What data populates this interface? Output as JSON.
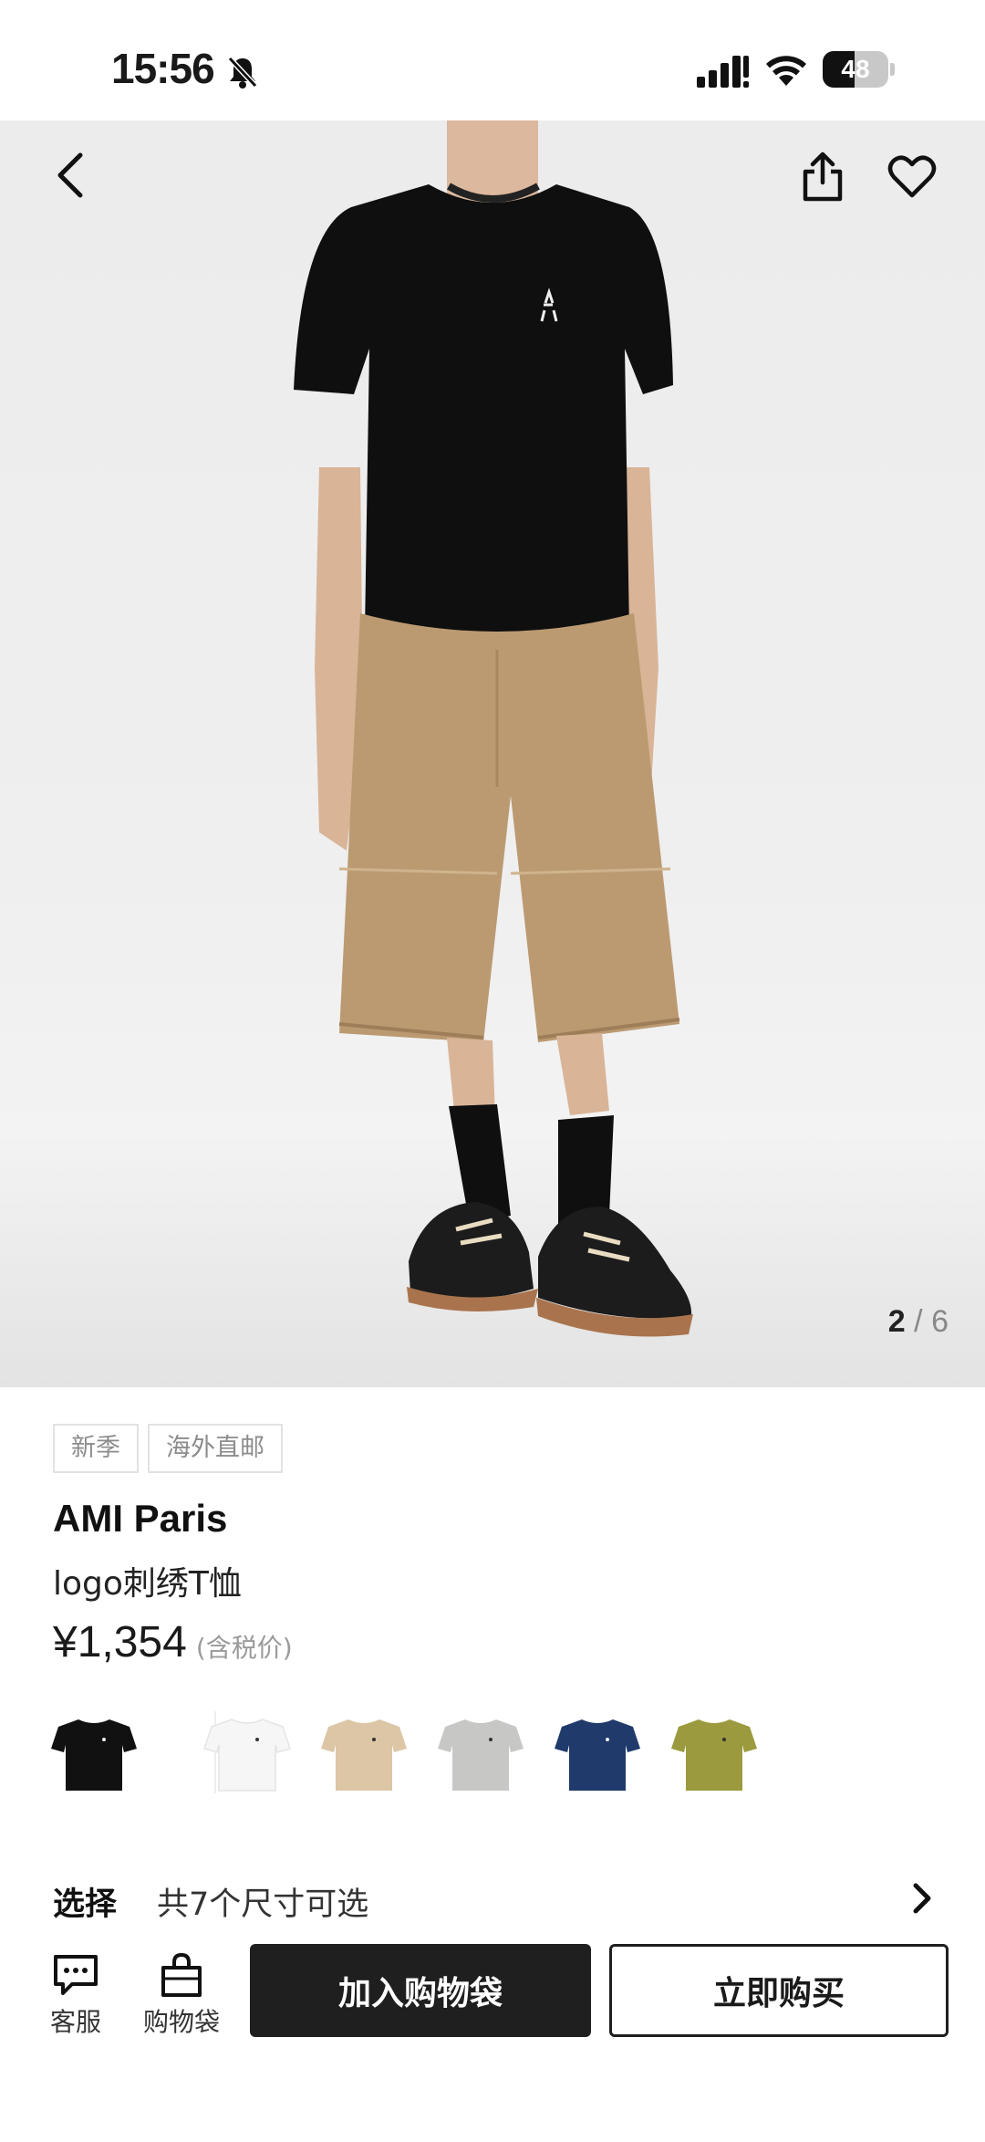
{
  "status_bar": {
    "time": "15:56",
    "battery": "48",
    "battery_level": 0.48
  },
  "gallery": {
    "current": "2",
    "separator": "/",
    "total": "6"
  },
  "tags": [
    "新季",
    "海外直邮"
  ],
  "product": {
    "brand": "AMI Paris",
    "name": "logo刺绣T恤",
    "price": "¥1,354",
    "price_note": "(含税价)"
  },
  "colors": [
    {
      "name": "black",
      "hex": "#111111",
      "selected": true
    },
    {
      "name": "white",
      "hex": "#f6f6f6",
      "selected": false
    },
    {
      "name": "beige",
      "hex": "#dcc6a6",
      "selected": false
    },
    {
      "name": "grey",
      "hex": "#c7c8c6",
      "selected": false
    },
    {
      "name": "navy",
      "hex": "#1f3a6b",
      "selected": false
    },
    {
      "name": "olive",
      "hex": "#9b9a3e",
      "selected": false
    }
  ],
  "size": {
    "label": "选择",
    "text": "共7个尺寸可选"
  },
  "bottom_bar": {
    "service_label": "客服",
    "bag_label": "购物袋",
    "add_to_cart": "加入购物袋",
    "buy_now": "立即购买"
  },
  "icons": [
    "bell-off-icon",
    "signal-icon",
    "wifi-icon",
    "back-icon",
    "share-icon",
    "heart-icon",
    "chevron-right-icon",
    "chat-icon",
    "bag-icon"
  ]
}
